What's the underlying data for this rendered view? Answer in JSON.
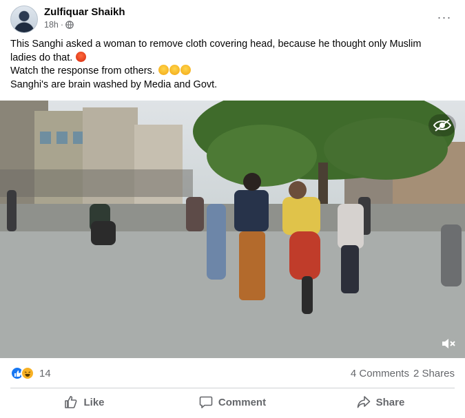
{
  "post": {
    "author": "Zulfiquar Shaikh",
    "time": "18h",
    "separator": "·",
    "privacy_icon": "globe-icon",
    "more_icon": "more-options-icon",
    "more_label": "···",
    "text_lines": [
      "This Sanghi asked a woman to remove cloth covering head, because he thought only Muslim",
      "ladies do that.",
      "Watch the response from others.",
      "Sanghi's are brain washed by Media and Govt."
    ],
    "emojis": {
      "line2": [
        "angry-face"
      ],
      "line3": [
        "rofl-face",
        "rofl-face",
        "rofl-face"
      ]
    }
  },
  "media": {
    "type": "video",
    "overlay_icons": [
      "eye-icon",
      "speaker-muted-icon"
    ]
  },
  "stats": {
    "reactions": [
      "like",
      "haha"
    ],
    "reaction_count": "14",
    "comments": "4 Comments",
    "shares": "2 Shares"
  },
  "actions": {
    "like": "Like",
    "comment": "Comment",
    "share": "Share"
  },
  "colors": {
    "text_primary": "#050505",
    "text_secondary": "#65676b",
    "like_blue": "#1877f2",
    "haha_yellow": "#f7b125",
    "divider": "#ced0d4"
  }
}
